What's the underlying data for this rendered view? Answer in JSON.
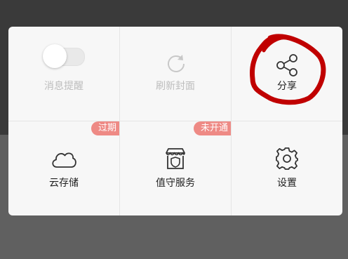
{
  "menu": {
    "items": [
      {
        "label": "消息提醒",
        "icon": "toggle-switch-icon",
        "state": "off",
        "enabled": false
      },
      {
        "label": "刷新封面",
        "icon": "refresh-icon",
        "enabled": false
      },
      {
        "label": "分享",
        "icon": "share-icon",
        "enabled": true
      },
      {
        "label": "云存储",
        "icon": "cloud-icon",
        "badge": "过期",
        "enabled": true
      },
      {
        "label": "值守服务",
        "icon": "storefront-shield-icon",
        "badge": "未开通",
        "enabled": true
      },
      {
        "label": "设置",
        "icon": "gear-icon",
        "enabled": true
      }
    ]
  },
  "colors": {
    "badge": "#ee8a85",
    "annotation": "#c00000",
    "disabled_text": "#bdbdbd",
    "text": "#222222"
  }
}
